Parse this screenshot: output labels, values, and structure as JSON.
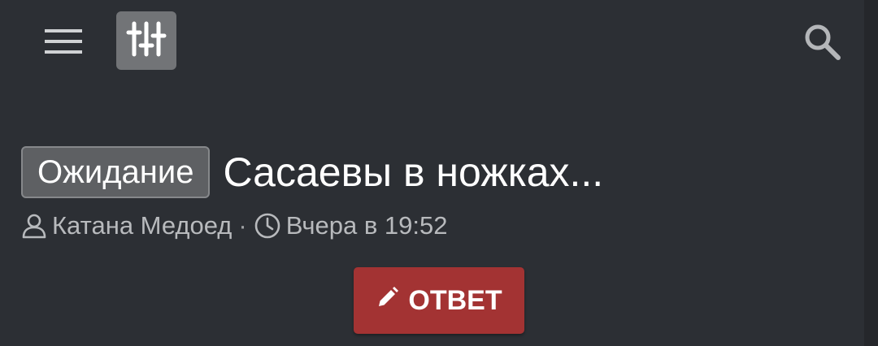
{
  "header": {
    "menu_icon": "hamburger-menu-icon",
    "filters_icon": "sliders-icon",
    "search_icon": "search-icon"
  },
  "thread": {
    "prefix": "Ожидание",
    "title": "Сасаевы в ножках...",
    "author": "Катана Медоед",
    "separator": "·",
    "time": "Вчера в 19:52",
    "author_icon": "user-icon",
    "time_icon": "clock-icon"
  },
  "actions": {
    "reply_label": "ОТВЕТ",
    "reply_icon": "pencil-icon",
    "reply_color": "#a33333"
  }
}
